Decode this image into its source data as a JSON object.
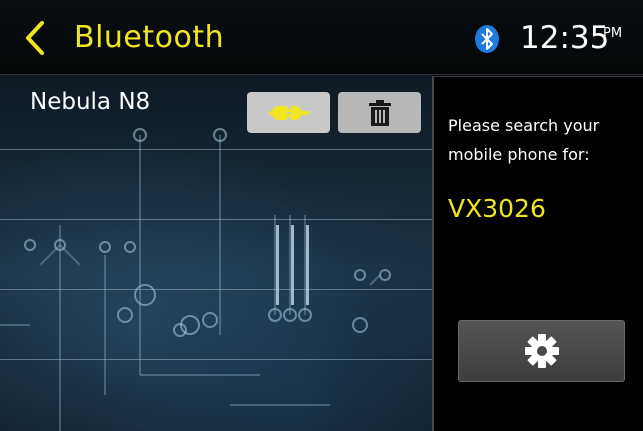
{
  "header": {
    "back_icon": "chevron-left-icon",
    "title": "Bluetooth",
    "bluetooth_icon": "bluetooth-icon",
    "time": "12:35",
    "ampm": "PM"
  },
  "devices": [
    {
      "name": "Nebula N8",
      "connect_icon": "connector-plug-icon",
      "delete_icon": "trash-icon"
    }
  ],
  "panel": {
    "message": "Please search your mobile phone for:",
    "pin": "VX3026",
    "settings_icon": "gear-icon"
  },
  "colors": {
    "accent_yellow": "#f0e61f",
    "bluetooth_blue": "#1e7be0",
    "panel_bg": "#000000"
  }
}
